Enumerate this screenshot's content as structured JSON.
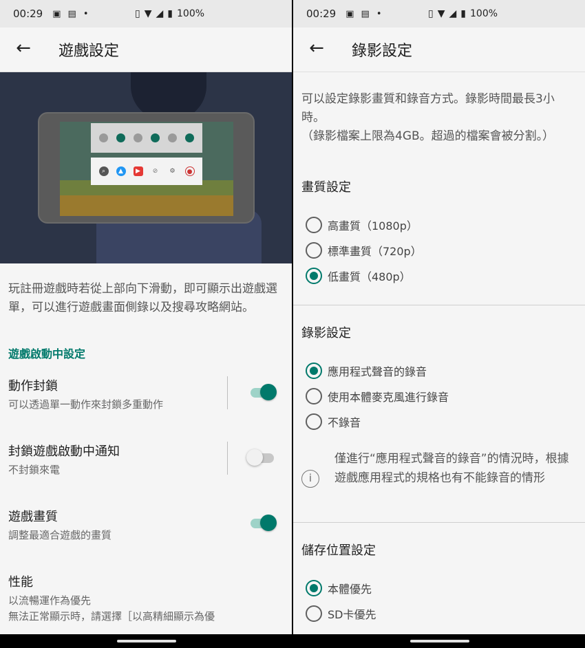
{
  "left": {
    "status": {
      "time": "00:29",
      "battery": "100%"
    },
    "appbar": {
      "title": "遊戲設定"
    },
    "description": "玩註冊遊戲時若從上部向下滑動，即可顯示出遊戲選單，可以進行遊戲畫面側錄以及搜尋攻略網站。",
    "section_label": "遊戲啟動中設定",
    "settings": [
      {
        "title": "動作封鎖",
        "subtitle": "可以透過單一動作來封鎖多重動作",
        "enabled": true
      },
      {
        "title": "封鎖遊戲啟動中通知",
        "subtitle": "不封鎖來電",
        "enabled": false
      },
      {
        "title": "遊戲畫質",
        "subtitle": "調整最適合遊戲的畫質",
        "enabled": true
      },
      {
        "title": "性能",
        "subtitle": "以流暢運作為優先",
        "subtitle2": "無法正常顯示時，請選擇［以高精細顯示為優"
      }
    ]
  },
  "right": {
    "status": {
      "time": "00:29",
      "battery": "100%"
    },
    "appbar": {
      "title": "錄影設定"
    },
    "description_1": "可以設定錄影畫質和錄音方式。錄影時間最長3小時。",
    "description_2": "（錄影檔案上限為4GB。超過的檔案會被分割。）",
    "quality": {
      "heading": "畫質設定",
      "options": [
        "高畫質（1080p）",
        "標準畫質（720p）",
        "低畫質（480p）"
      ],
      "selected": 2
    },
    "recording": {
      "heading": "錄影設定",
      "options": [
        "應用程式聲音的錄音",
        "使用本體麥克風進行錄音",
        "不錄音"
      ],
      "selected": 0,
      "note": "僅進行“應用程式聲音的錄音”的情況時，根據遊戲應用程式的規格也有不能錄音的情形"
    },
    "storage": {
      "heading": "儲存位置設定",
      "options": [
        "本體優先",
        "SD卡優先"
      ],
      "selected": 0
    }
  },
  "colors": {
    "accent": "#00796b",
    "toggle_track_on": "#9ed3c8"
  }
}
